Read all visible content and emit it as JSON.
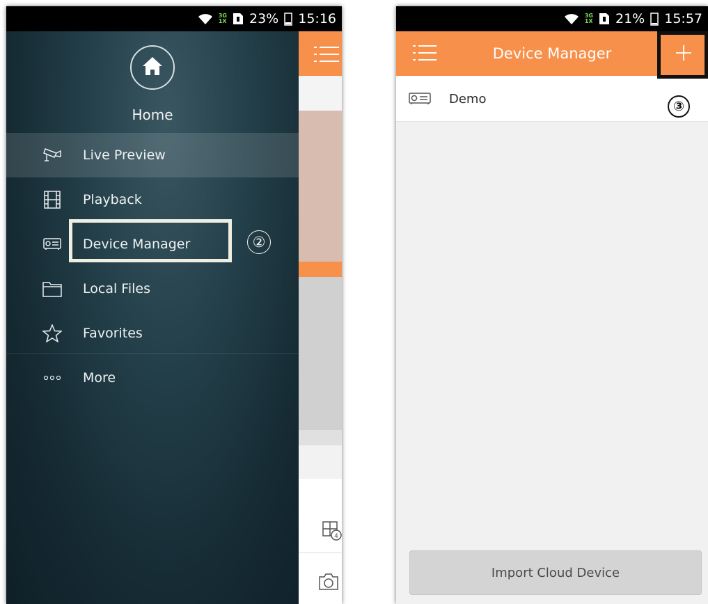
{
  "left_phone": {
    "status_bar": {
      "network": [
        "3G",
        "1X"
      ],
      "battery": "23%",
      "time": "15:16"
    },
    "drawer": {
      "home_label": "Home",
      "items": [
        {
          "label": "Live Preview",
          "icon": "camera-icon"
        },
        {
          "label": "Playback",
          "icon": "film-icon"
        },
        {
          "label": "Device Manager",
          "icon": "dvr-icon"
        },
        {
          "label": "Local Files",
          "icon": "folder-icon"
        },
        {
          "label": "Favorites",
          "icon": "star-icon"
        },
        {
          "label": "More",
          "icon": "more-dots-icon"
        }
      ],
      "active_item": "Live Preview"
    },
    "callout": "②"
  },
  "right_phone": {
    "status_bar": {
      "network": [
        "3G",
        "1X"
      ],
      "battery": "21%",
      "time": "15:57"
    },
    "title": "Device Manager",
    "devices": [
      {
        "name": "Demo",
        "icon": "dvr-icon"
      }
    ],
    "callout": "③",
    "import_button": "Import Cloud Device"
  },
  "colors": {
    "accent": "#f7904a",
    "drawer_bg": "#1c333d"
  }
}
